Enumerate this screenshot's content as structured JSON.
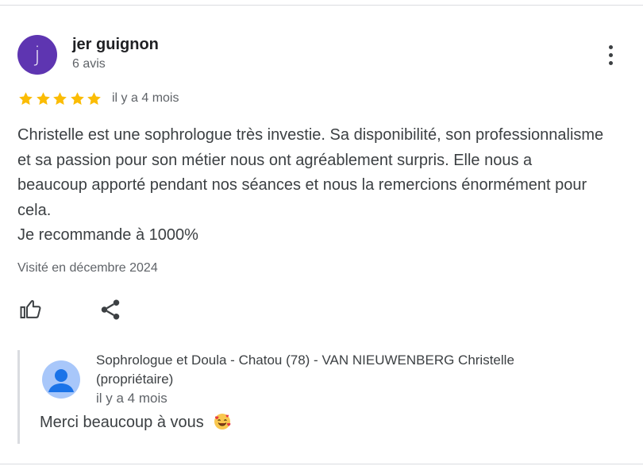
{
  "review": {
    "author_initial": "j",
    "author_name": "jer guignon",
    "author_meta": "6 avis",
    "rating": 5,
    "date": "il y a 4 mois",
    "text": [
      "Christelle est une sophrologue très investie. Sa disponibilité, son professionnalisme et sa passion pour son métier nous ont agréablement surpris. Elle nous a beaucoup apporté pendant nos séances et nous la remercions énormément pour cela.",
      "Je recommande à 1000%"
    ],
    "visited": "Visité en décembre 2024",
    "avatar_color": "#5e35b1",
    "star_color": "#fbbc04",
    "icons": {
      "menu": "more-vert-icon",
      "like": "thumb-up-icon",
      "share": "share-icon"
    }
  },
  "reply": {
    "owner_name": "Sophrologue et Doula - Chatou (78) - VAN NIEUWENBERG Christelle (propriétaire)",
    "date": "il y a 4 mois",
    "text": "Merci beaucoup à vous",
    "emoji": "smiling-face-with-hearts-emoji"
  }
}
